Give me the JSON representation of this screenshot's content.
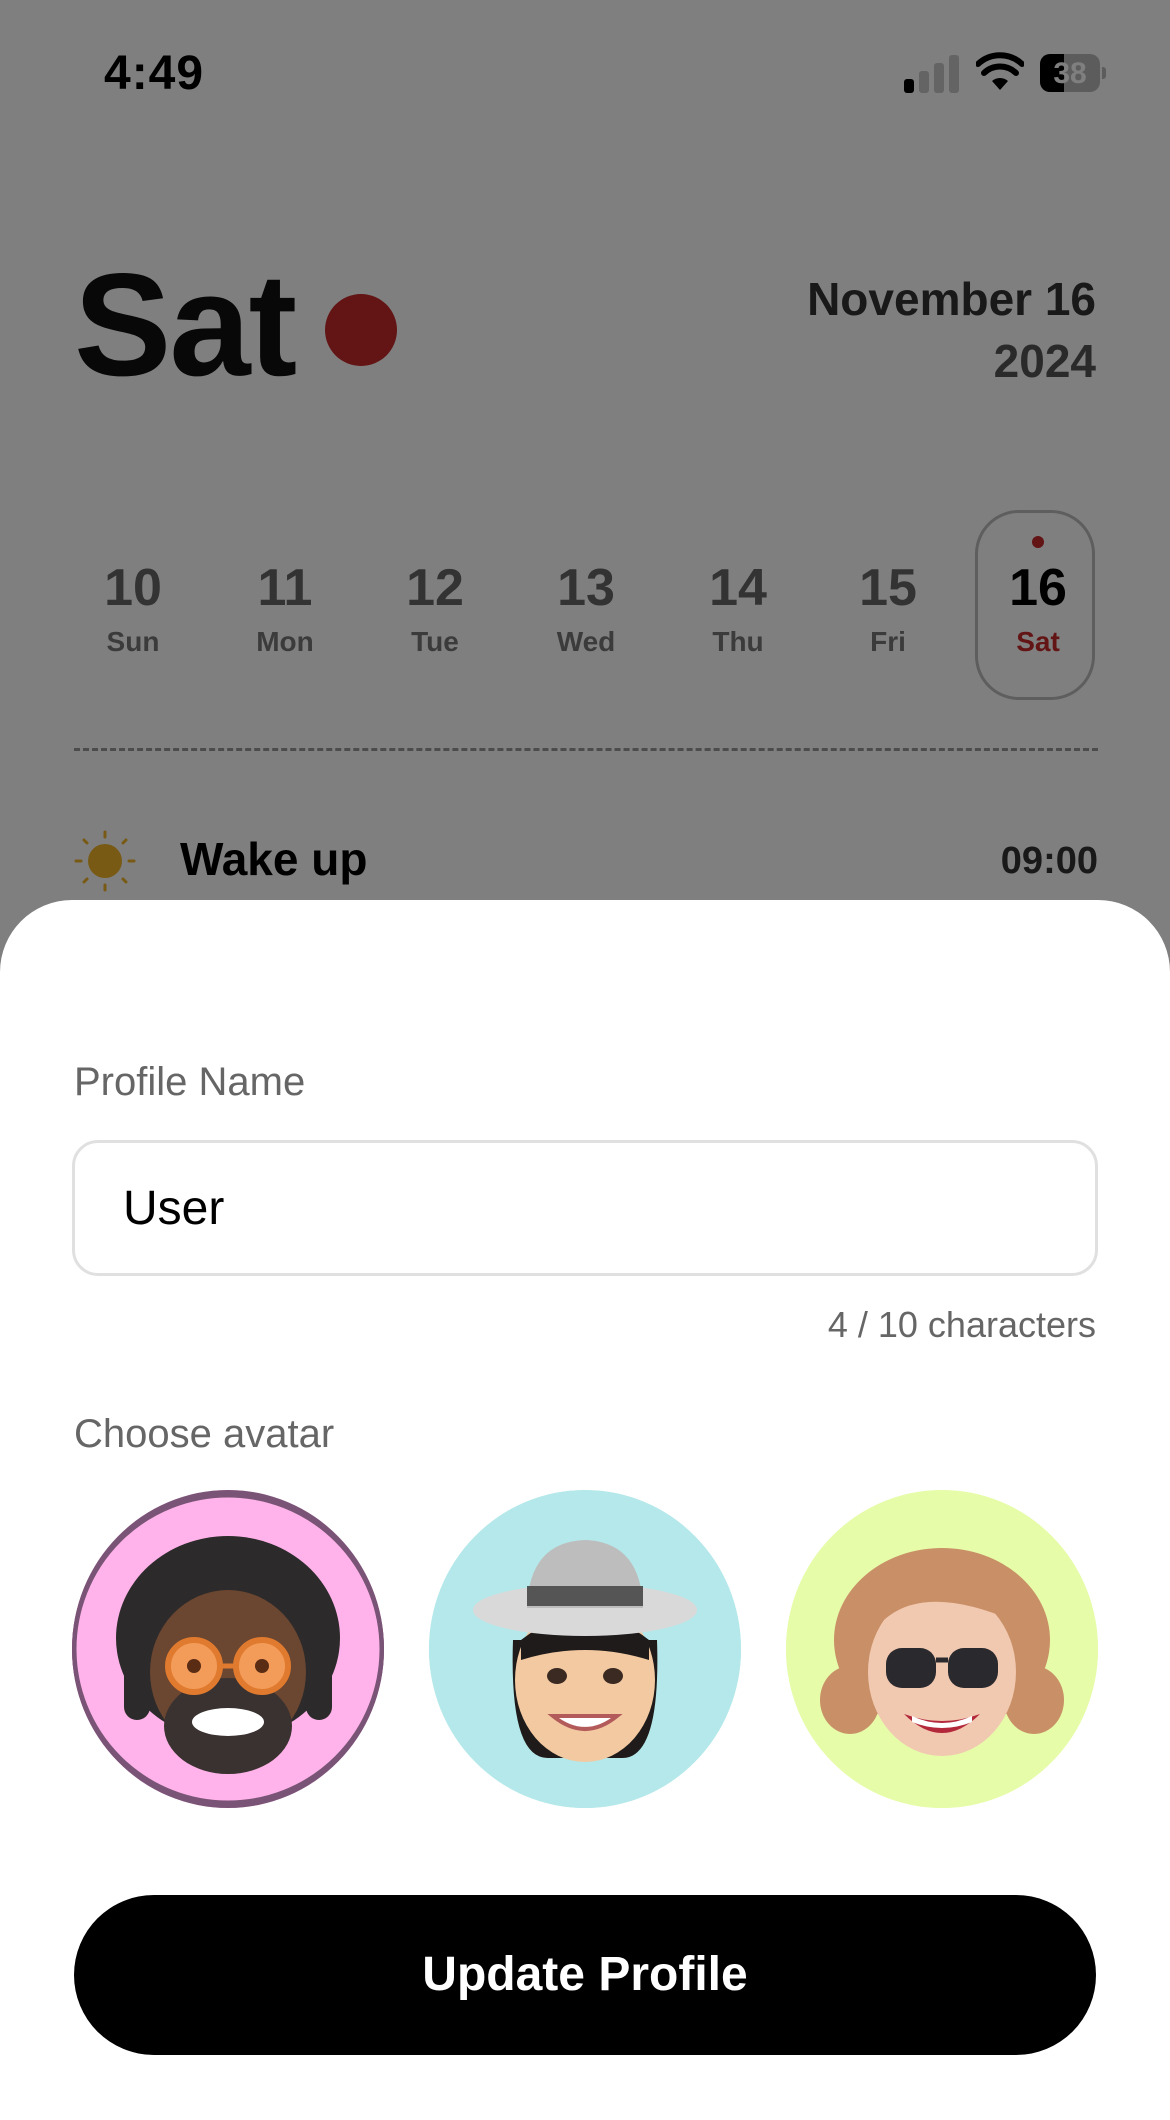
{
  "status_bar": {
    "time": "4:49",
    "battery": "38"
  },
  "header": {
    "day": "Sat",
    "date_line1": "November 16",
    "date_line2": "2024",
    "accent_color": "#c62828"
  },
  "week": [
    {
      "num": "10",
      "name": "Sun"
    },
    {
      "num": "11",
      "name": "Mon"
    },
    {
      "num": "12",
      "name": "Tue"
    },
    {
      "num": "13",
      "name": "Wed"
    },
    {
      "num": "14",
      "name": "Thu"
    },
    {
      "num": "15",
      "name": "Fri"
    },
    {
      "num": "16",
      "name": "Sat",
      "selected": true
    }
  ],
  "task": {
    "title": "Wake up",
    "time": "09:00",
    "icon": "sun-icon"
  },
  "sheet": {
    "name_label": "Profile Name",
    "name_value": "User",
    "char_count": "4 / 10 characters",
    "avatar_label": "Choose avatar",
    "avatars": [
      {
        "bg": "#ffb3ea",
        "icon": "avatar-memoji-dreadlocks",
        "selected": true
      },
      {
        "bg": "#b5e8ea",
        "icon": "avatar-memoji-hat"
      },
      {
        "bg": "#e6fca9",
        "icon": "avatar-memoji-sunglasses"
      }
    ],
    "button_label": "Update Profile"
  }
}
